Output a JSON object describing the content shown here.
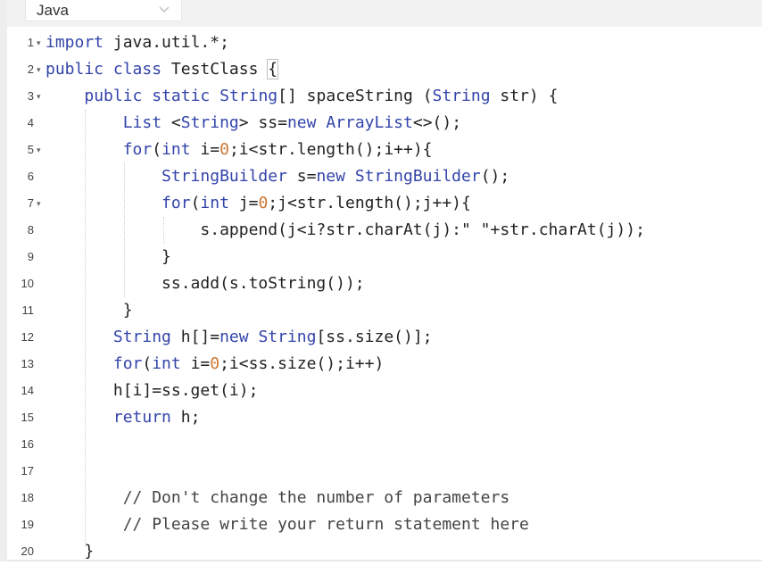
{
  "language_selector": {
    "value": "Java",
    "icon": "chevron-down-icon"
  },
  "editor": {
    "lines": [
      {
        "num": "1",
        "fold": true,
        "code": "import java.util.*;"
      },
      {
        "num": "2",
        "fold": true,
        "code": "public class TestClass {"
      },
      {
        "num": "3",
        "fold": true,
        "code": "    public static String[] spaceString (String str) {"
      },
      {
        "num": "4",
        "fold": false,
        "code": "        List <String> ss=new ArrayList<>();"
      },
      {
        "num": "5",
        "fold": true,
        "code": "        for(int i=0;i<str.length();i++){"
      },
      {
        "num": "6",
        "fold": false,
        "code": "            StringBuilder s=new StringBuilder();"
      },
      {
        "num": "7",
        "fold": true,
        "code": "            for(int j=0;j<str.length();j++){"
      },
      {
        "num": "8",
        "fold": false,
        "code": "                s.append(j<i?str.charAt(j):\" \"+str.charAt(j));"
      },
      {
        "num": "9",
        "fold": false,
        "code": "            }"
      },
      {
        "num": "10",
        "fold": false,
        "code": "            ss.add(s.toString());"
      },
      {
        "num": "11",
        "fold": false,
        "code": "        }"
      },
      {
        "num": "12",
        "fold": false,
        "code": "       String h[]=new String[ss.size()];"
      },
      {
        "num": "13",
        "fold": false,
        "code": "       for(int i=0;i<ss.size();i++)"
      },
      {
        "num": "14",
        "fold": false,
        "code": "       h[i]=ss.get(i);"
      },
      {
        "num": "15",
        "fold": false,
        "code": "       return h;"
      },
      {
        "num": "16",
        "fold": false,
        "code": ""
      },
      {
        "num": "17",
        "fold": false,
        "code": ""
      },
      {
        "num": "18",
        "fold": false,
        "code": "        // Don't change the number of parameters"
      },
      {
        "num": "19",
        "fold": false,
        "code": "        // Please write your return statement here"
      },
      {
        "num": "20",
        "fold": false,
        "code": "    }"
      }
    ]
  },
  "colors": {
    "keyword": "#3344aa",
    "number": "#cc7733",
    "text": "#222222",
    "gutter": "#444444"
  }
}
